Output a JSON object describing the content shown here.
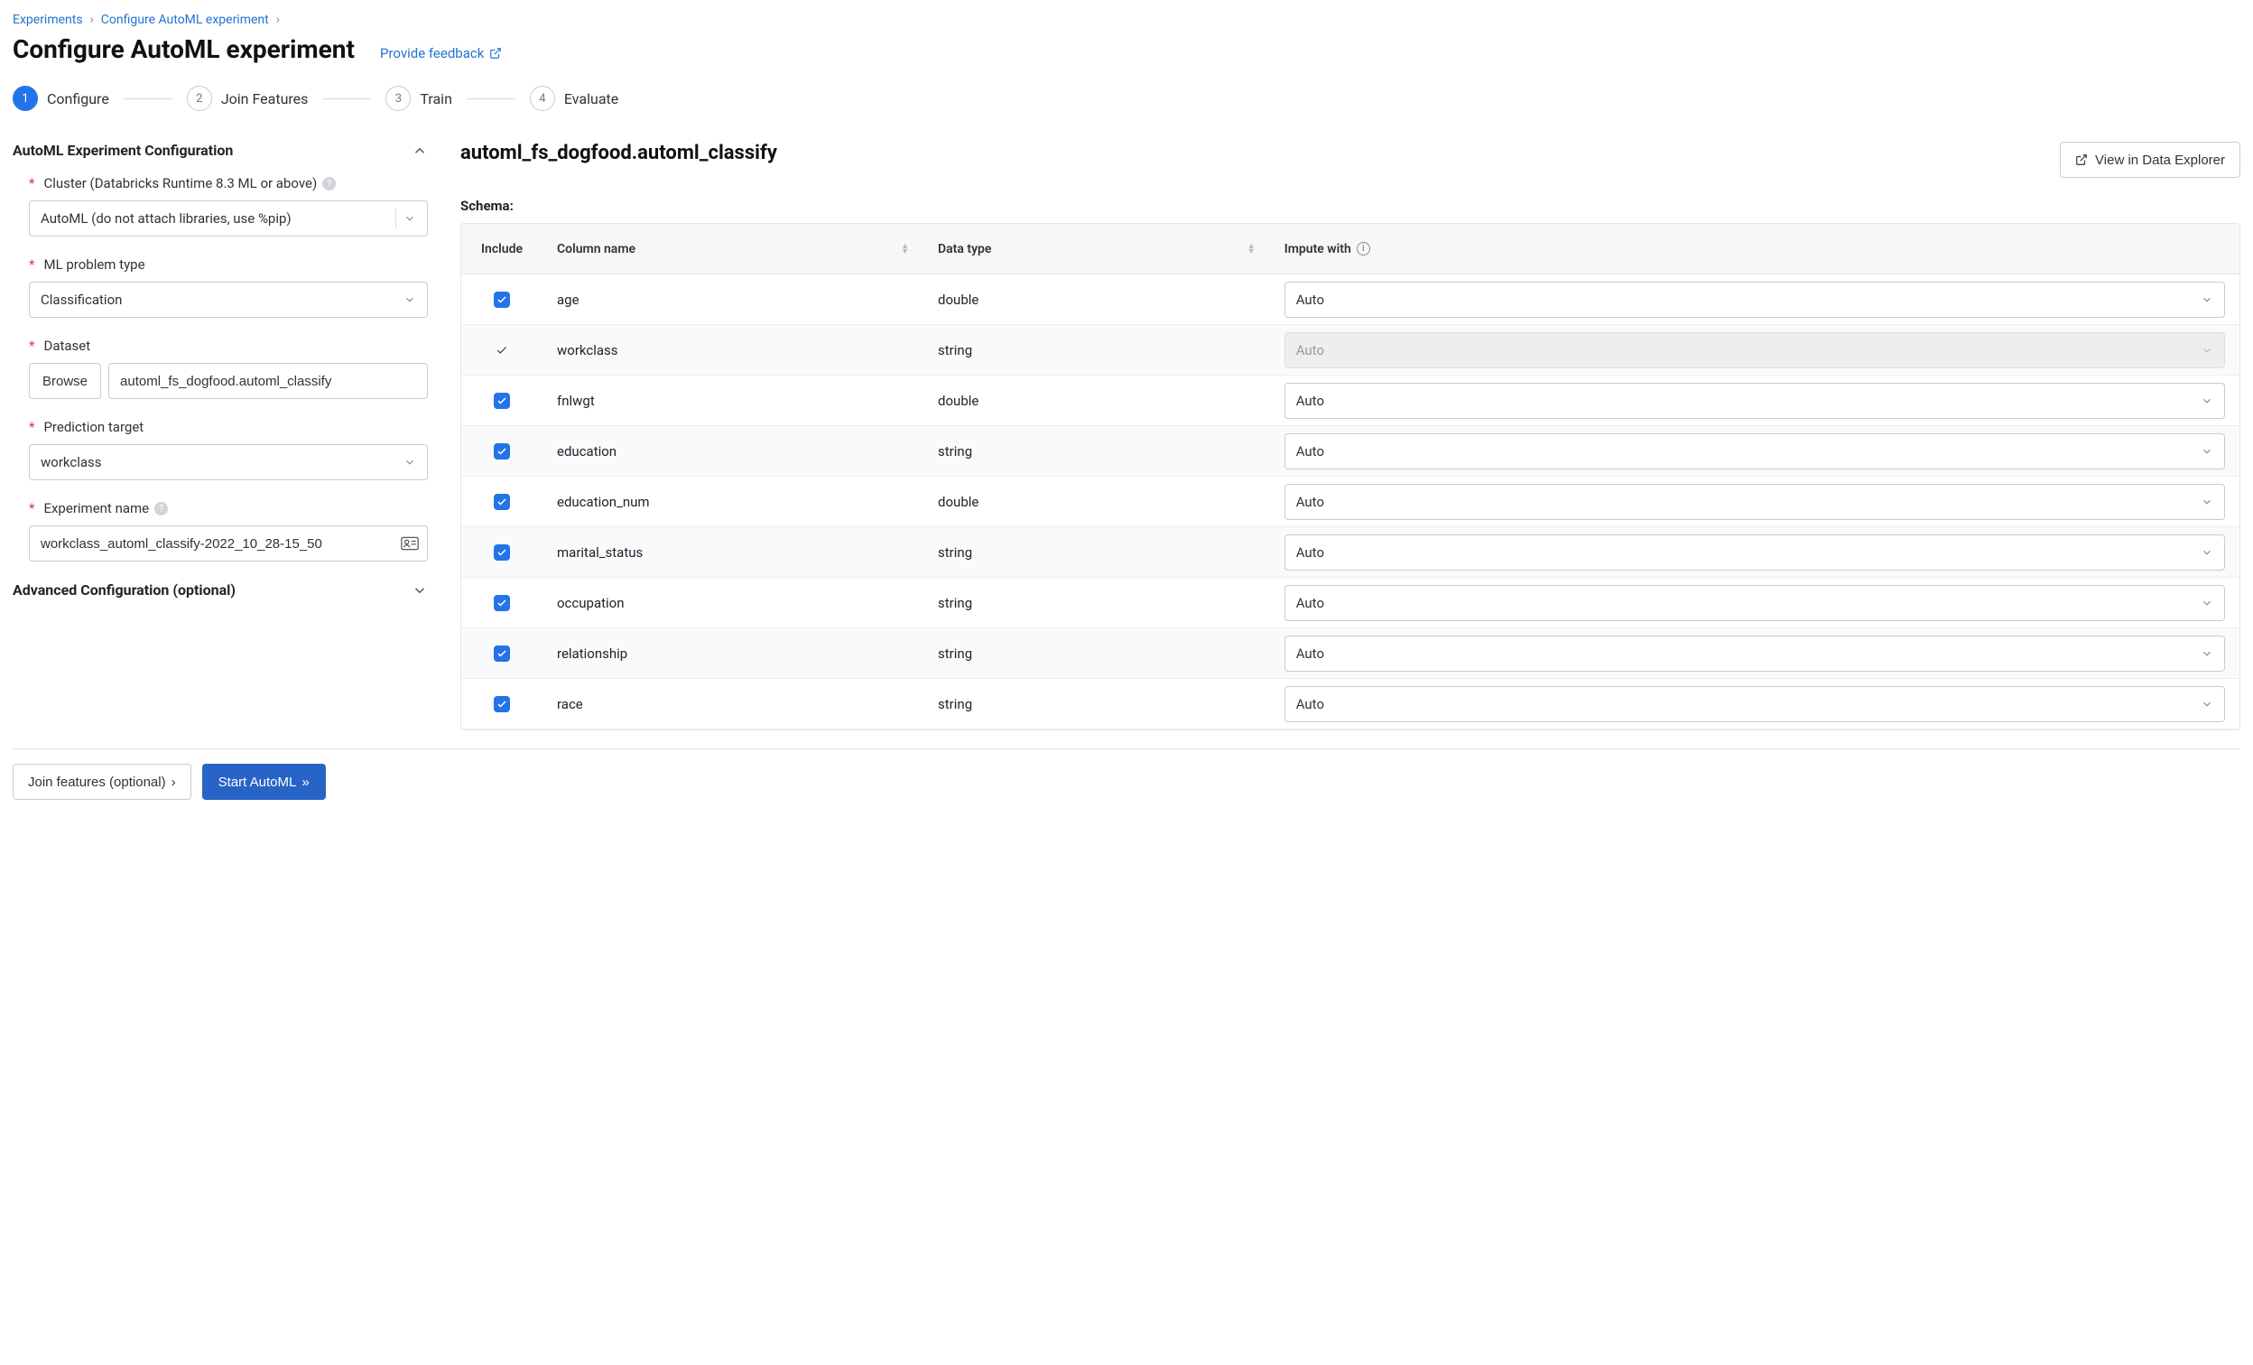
{
  "breadcrumb": {
    "items": [
      "Experiments",
      "Configure AutoML experiment"
    ]
  },
  "page": {
    "title": "Configure AutoML experiment",
    "feedback_label": "Provide feedback"
  },
  "stepper": {
    "steps": [
      {
        "num": "1",
        "label": "Configure"
      },
      {
        "num": "2",
        "label": "Join Features"
      },
      {
        "num": "3",
        "label": "Train"
      },
      {
        "num": "4",
        "label": "Evaluate"
      }
    ]
  },
  "config": {
    "section_title": "AutoML Experiment Configuration",
    "cluster_label": "Cluster (Databricks Runtime 8.3 ML or above)",
    "cluster_value": "AutoML (do not attach libraries, use %pip)",
    "problem_type_label": "ML problem type",
    "problem_type_value": "Classification",
    "dataset_label": "Dataset",
    "browse_label": "Browse",
    "dataset_value": "automl_fs_dogfood.automl_classify",
    "prediction_target_label": "Prediction target",
    "prediction_target_value": "workclass",
    "experiment_name_label": "Experiment name",
    "experiment_name_value": "workclass_automl_classify-2022_10_28-15_50",
    "advanced_title": "Advanced Configuration (optional)"
  },
  "right": {
    "dataset_title": "automl_fs_dogfood.automl_classify",
    "view_explorer_label": "View in Data Explorer",
    "schema_label": "Schema:",
    "columns": {
      "include": "Include",
      "column_name": "Column name",
      "data_type": "Data type",
      "impute_with": "Impute with"
    },
    "rows": [
      {
        "include": "checked",
        "name": "age",
        "type": "double",
        "impute": "Auto",
        "disabled": false
      },
      {
        "include": "locked",
        "name": "workclass",
        "type": "string",
        "impute": "Auto",
        "disabled": true
      },
      {
        "include": "checked",
        "name": "fnlwgt",
        "type": "double",
        "impute": "Auto",
        "disabled": false
      },
      {
        "include": "checked",
        "name": "education",
        "type": "string",
        "impute": "Auto",
        "disabled": false
      },
      {
        "include": "checked",
        "name": "education_num",
        "type": "double",
        "impute": "Auto",
        "disabled": false
      },
      {
        "include": "checked",
        "name": "marital_status",
        "type": "string",
        "impute": "Auto",
        "disabled": false
      },
      {
        "include": "checked",
        "name": "occupation",
        "type": "string",
        "impute": "Auto",
        "disabled": false
      },
      {
        "include": "checked",
        "name": "relationship",
        "type": "string",
        "impute": "Auto",
        "disabled": false
      },
      {
        "include": "checked",
        "name": "race",
        "type": "string",
        "impute": "Auto",
        "disabled": false
      }
    ]
  },
  "footer": {
    "join_features_label": "Join features (optional)",
    "start_automl_label": "Start AutoML"
  }
}
